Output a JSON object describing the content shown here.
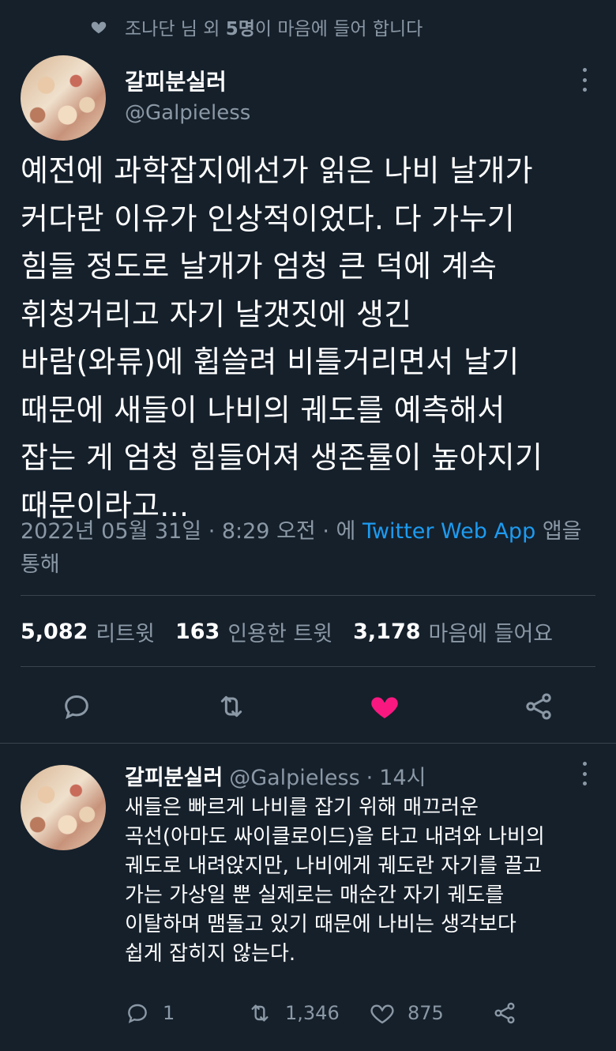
{
  "liked_by": {
    "prefix": "조나단 님 외",
    "count": "5명",
    "suffix": "이 마음에 들어 합니다"
  },
  "tweet": {
    "display_name": "갈피분실러",
    "handle": "@Galpieless",
    "text": "예전에 과학잡지에선가 읽은 나비 날개가\n커다란 이유가 인상적이었다. 다 가누기\n힘들 정도로 날개가 엄청 큰 덕에 계속\n휘청거리고 자기 날갯짓에 생긴\n바람(와류)에 휩쓸려 비틀거리면서 날기\n때문에 새들이 나비의 궤도를 예측해서\n잡는 게 엄청 힘들어져 생존률이 높아지기\n때문이라고...",
    "date": "2022년 05월 31일 · 8:29 오전 · 에",
    "app": "Twitter Web App",
    "app_suffix": "앱을\n통해"
  },
  "stats": {
    "retweets": "5,082",
    "retweets_label": "리트윗",
    "quotes": "163",
    "quotes_label": "인용한 트윗",
    "likes": "3,178",
    "likes_label": "마음에 들어요"
  },
  "actions": {
    "reply_icon": "comment-icon",
    "retweet_icon": "retweet-icon",
    "like_icon": "heart-icon",
    "share_icon": "share-icon",
    "like_color": "#f91880"
  },
  "reply": {
    "display_name": "갈피분실러",
    "handle": "@Galpieless",
    "separator": "·",
    "time": "14시",
    "text": "새들은 빠르게 나비를 잡기 위해 매끄러운\n곡선(아마도 싸이클로이드)을 타고 내려와 나비의\n궤도로 내려앉지만, 나비에게 궤도란 자기를 끌고\n가는 가상일 뿐 실제로는 매순간 자기 궤도를\n이탈하며 맴돌고 있기 때문에 나비는 생각보다\n쉽게 잡히지 않는다.",
    "replies": "1",
    "retweets": "1,346",
    "likes": "875"
  }
}
